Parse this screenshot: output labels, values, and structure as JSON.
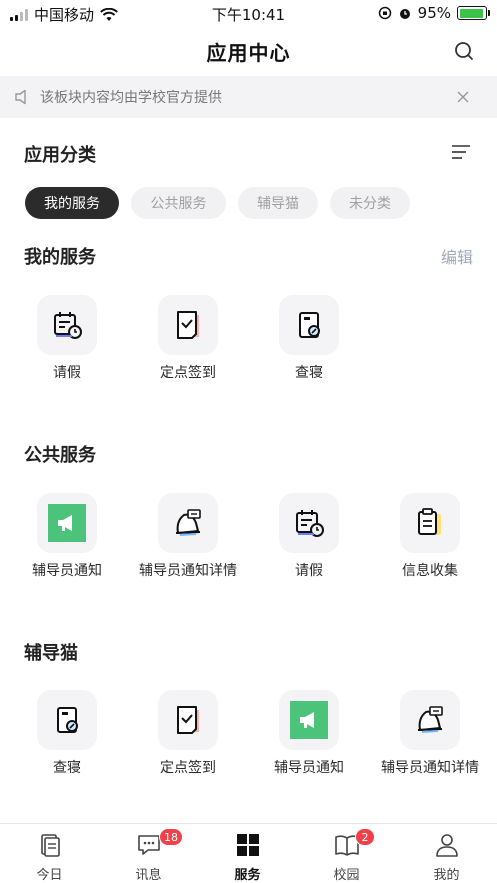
{
  "status": {
    "carrier": "中国移动",
    "time": "下午10:41",
    "battery": "95%",
    "battery_level": 0.95
  },
  "nav": {
    "title": "应用中心"
  },
  "notice": {
    "text": "该板块内容均由学校官方提供"
  },
  "category": {
    "title": "应用分类",
    "pills": [
      "我的服务",
      "公共服务",
      "辅导猫",
      "未分类"
    ],
    "active": "我的服务"
  },
  "sections": [
    {
      "title": "我的服务",
      "action": "编辑",
      "apps": [
        {
          "label": "请假",
          "icon": "calendar-clock-icon"
        },
        {
          "label": "定点签到",
          "icon": "checkin-icon"
        },
        {
          "label": "查寝",
          "icon": "dorm-check-icon"
        }
      ]
    },
    {
      "title": "公共服务",
      "apps": [
        {
          "label": "辅导员通知",
          "icon": "megaphone-icon"
        },
        {
          "label": "辅导员通知详情",
          "icon": "alarm-bell-icon"
        },
        {
          "label": "请假",
          "icon": "calendar-clock-icon"
        },
        {
          "label": "信息收集",
          "icon": "info-collect-icon"
        }
      ]
    },
    {
      "title": "辅导猫",
      "apps": [
        {
          "label": "查寝",
          "icon": "dorm-check-icon"
        },
        {
          "label": "定点签到",
          "icon": "checkin-icon"
        },
        {
          "label": "辅导员通知",
          "icon": "megaphone-icon"
        },
        {
          "label": "辅导员通知详情",
          "icon": "alarm-bell-icon"
        }
      ]
    }
  ],
  "tabbar": [
    {
      "label": "今日",
      "icon": "document-icon"
    },
    {
      "label": "讯息",
      "icon": "chat-icon",
      "badge": "18"
    },
    {
      "label": "服务",
      "icon": "grid-icon",
      "active": true
    },
    {
      "label": "校园",
      "icon": "book-icon",
      "badge": "2"
    },
    {
      "label": "我的",
      "icon": "person-icon"
    }
  ],
  "colors": {
    "accent_green": "#4cc37b",
    "badge_red": "#f0414a",
    "active_pill": "#2b2b2b"
  }
}
